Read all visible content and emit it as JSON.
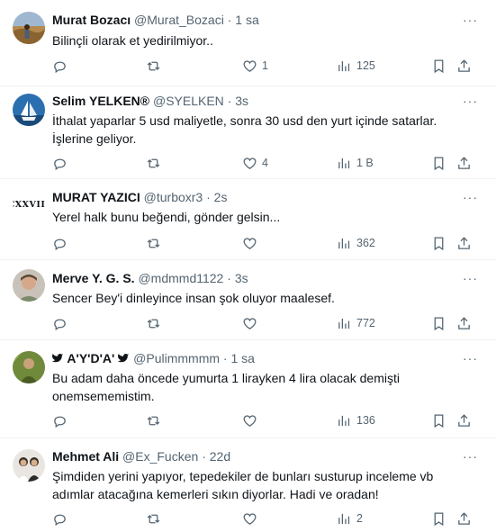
{
  "tweets": [
    {
      "name": "Murat Bozacı",
      "handle": "@Murat_Bozaci",
      "time": "1 sa",
      "text": "Bilinçli olarak et yedirilmiyor..",
      "replies": "",
      "retweets": "",
      "likes": "1",
      "views": "125",
      "avatar": "photo-landscape"
    },
    {
      "name": "Selim YELKEN®",
      "handle": "@SYELKEN",
      "time": "3s",
      "text": "İthalat yaparlar 5 usd maliyetle, sonra 30 usd den yurt içinde satarlar. İşlerine geliyor.",
      "replies": "",
      "retweets": "",
      "likes": "4",
      "views": "1 B",
      "avatar": "photo-sailing-ship"
    },
    {
      "name": "MURAT YAZICI",
      "handle": "@turboxr3",
      "time": "2s",
      "text": "Yerel halk bunu beğendi, gönder gelsin...",
      "replies": "",
      "retweets": "",
      "likes": "",
      "views": "362",
      "avatar": "text-logo",
      "avatar_text": "CXXVIII"
    },
    {
      "name": "Merve Y. G. S.",
      "handle": "@mdmmd1122",
      "time": "3s",
      "text": "Sencer Bey'i dinleyince insan şok oluyor maalesef.",
      "replies": "",
      "retweets": "",
      "likes": "",
      "views": "772",
      "avatar": "photo-person"
    },
    {
      "name": "A'Y'D'A'",
      "handle": "@Pulimmmmm",
      "time": "1 sa",
      "text": "Bu adam daha öncede yumurta 1 lirayken 4 lira olacak demişti onemsememistim.",
      "replies": "",
      "retweets": "",
      "likes": "",
      "views": "136",
      "avatar": "photo-green"
    },
    {
      "name": "Mehmet Ali",
      "handle": "@Ex_Fucken",
      "time": "22d",
      "text": "Şimdiden yerini yapıyor, tepedekiler de bunları susturup inceleme vb adımlar atacağına kemerleri sıkın diyorlar. Hadi ve oradan!",
      "replies": "",
      "retweets": "",
      "likes": "",
      "views": "2",
      "avatar": "photo-two-people"
    }
  ],
  "ui": {
    "dot": "·",
    "more": "···",
    "bird": "🐦"
  },
  "colors": {
    "text": "#0f1419",
    "muted": "#536471",
    "divider": "#eff3f4"
  }
}
